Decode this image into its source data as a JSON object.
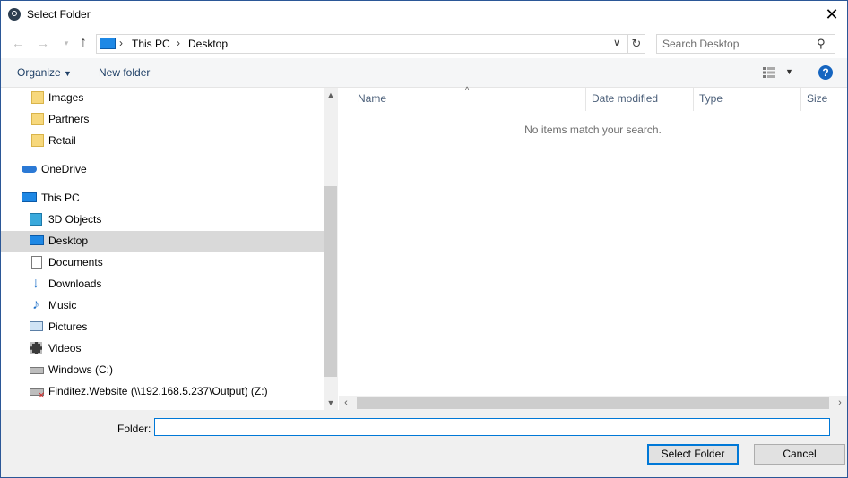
{
  "window": {
    "title": "Select Folder"
  },
  "address": {
    "crumbs": [
      "This PC",
      "Desktop"
    ],
    "search_placeholder": "Search Desktop"
  },
  "toolbar": {
    "organize": "Organize",
    "new_folder": "New folder"
  },
  "nav": {
    "items": [
      {
        "label": "Images",
        "icon": "folder-icon"
      },
      {
        "label": "Partners",
        "icon": "folder-icon"
      },
      {
        "label": "Retail",
        "icon": "folder-icon"
      },
      {
        "label": "OneDrive",
        "icon": "onedrive-icon"
      },
      {
        "label": "This PC",
        "icon": "this-pc-icon"
      },
      {
        "label": "3D Objects",
        "icon": "3d-objects-icon"
      },
      {
        "label": "Desktop",
        "icon": "desktop-icon",
        "selected": true
      },
      {
        "label": "Documents",
        "icon": "documents-icon"
      },
      {
        "label": "Downloads",
        "icon": "downloads-icon"
      },
      {
        "label": "Music",
        "icon": "music-icon"
      },
      {
        "label": "Pictures",
        "icon": "pictures-icon"
      },
      {
        "label": "Videos",
        "icon": "videos-icon"
      },
      {
        "label": "Windows (C:)",
        "icon": "drive-icon"
      },
      {
        "label": "Finditez.Website (\\\\192.168.5.237\\Output) (Z:)",
        "icon": "network-drive-disconnected-icon"
      }
    ]
  },
  "content": {
    "columns": [
      "Name",
      "Date modified",
      "Type",
      "Size"
    ],
    "empty_message": "No items match your search."
  },
  "footer": {
    "folder_label": "Folder:",
    "folder_value": "",
    "select_button": "Select Folder",
    "cancel_button": "Cancel"
  },
  "colors": {
    "accent": "#0078d7",
    "selection": "#d9d9d9",
    "help": "#1565c0"
  }
}
